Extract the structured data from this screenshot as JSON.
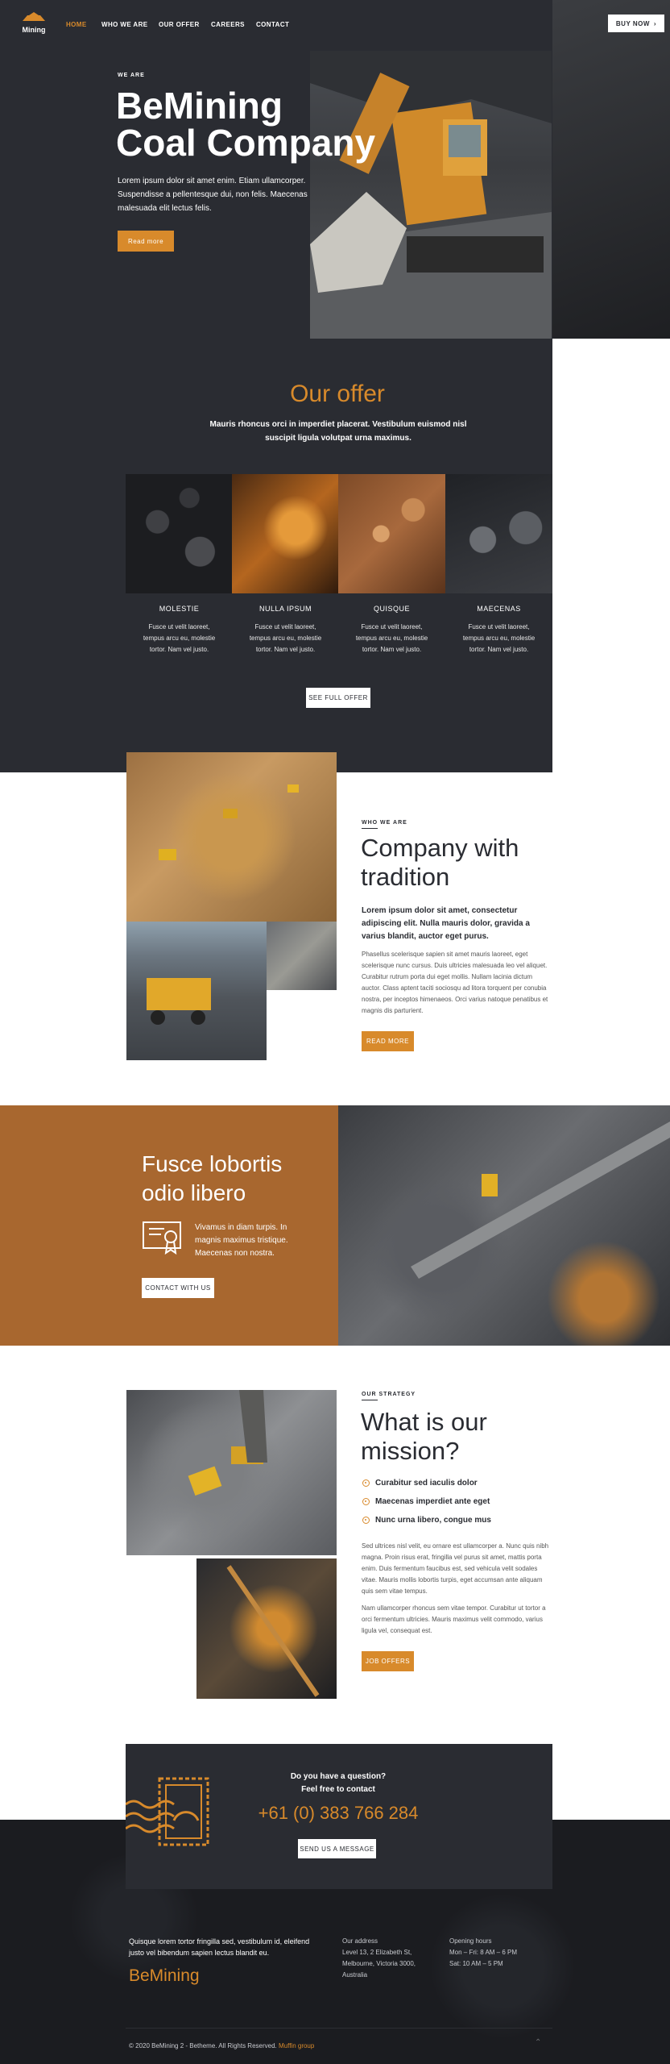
{
  "brand": {
    "logo_text": "Mining",
    "accent": "#d88a2b",
    "dark": "#2a2c32",
    "rust": "#a8672f"
  },
  "nav": {
    "items": [
      "HOME",
      "WHO WE ARE",
      "OUR OFFER",
      "CAREERS",
      "CONTACT"
    ],
    "buy": "BUY NOW"
  },
  "hero": {
    "eyebrow": "WE ARE",
    "title_1": "BeMining",
    "title_2": "Coal Company",
    "text": "Lorem ipsum dolor sit amet enim. Etiam ullamcorper. Suspendisse a pellentesque dui, non felis. Maecenas malesuada elit lectus felis.",
    "button": "Read more"
  },
  "offer": {
    "title": "Our offer",
    "subtitle": "Mauris rhoncus orci in imperdiet placerat. Vestibulum euismod nisl suscipit ligula volutpat urna maximus.",
    "items": [
      {
        "title": "MOLESTIE",
        "text": "Fusce ut velit laoreet, tempus arcu eu, molestie tortor. Nam vel justo."
      },
      {
        "title": "NULLA IPSUM",
        "text": "Fusce ut velit laoreet, tempus arcu eu, molestie tortor. Nam vel justo."
      },
      {
        "title": "QUISQUE",
        "text": "Fusce ut velit laoreet, tempus arcu eu, molestie tortor. Nam vel justo."
      },
      {
        "title": "MAECENAS",
        "text": "Fusce ut velit laoreet, tempus arcu eu, molestie tortor. Nam vel justo."
      }
    ],
    "button": "SEE FULL OFFER"
  },
  "company": {
    "eyebrow": "WHO WE ARE",
    "title_1": "Company with",
    "title_2": "tradition",
    "lead": "Lorem ipsum dolor sit amet, consectetur adipiscing elit. Nulla mauris dolor, gravida a varius blandit, auctor eget purus.",
    "text": "Phasellus scelerisque sapien sit amet mauris laoreet, eget scelerisque nunc cursus. Duis ultricies malesuada leo vel aliquet. Curabitur rutrum porta dui eget mollis. Nullam lacinia dictum auctor. Class aptent taciti sociosqu ad litora torquent per conubia nostra, per inceptos himenaeos. Orci varius natoque penatibus et magnis dis parturient.",
    "button": "READ MORE"
  },
  "promo": {
    "title_1": "Fusce lobortis",
    "title_2": "odio libero",
    "text": "Vivamus in diam turpis. In magnis maximus tristique. Maecenas non nostra.",
    "button": "CONTACT WITH US"
  },
  "mission": {
    "eyebrow": "OUR STRATEGY",
    "title_1": "What is our",
    "title_2": "mission?",
    "checks": [
      "Curabitur sed iaculis dolor",
      "Maecenas imperdiet ante eget",
      "Nunc urna libero, congue mus"
    ],
    "text_1": "Sed ultrices nisl velit, eu ornare est ullamcorper a. Nunc quis nibh magna. Proin risus erat, fringilla vel purus sit amet, mattis porta enim. Duis fermentum faucibus est, sed vehicula velit sodales vitae. Mauris mollis lobortis turpis, eget accumsan ante aliquam quis sem vitae tempus.",
    "text_2": "Nam ullamcorper rhoncus sem vitae tempor. Curabitur ut tortor a orci fermentum ultricies. Mauris maximus velit commodo, varius ligula vel, consequat est.",
    "button": "JOB OFFERS"
  },
  "contact": {
    "line_1": "Do you have a question?",
    "line_2": "Feel free to contact",
    "phone": "+61 (0) 383 766 284",
    "button": "SEND US A MESSAGE"
  },
  "footer": {
    "about": "Quisque lorem tortor fringilla sed, vestibulum id, eleifend justo vel bibendum sapien lectus blandit eu.",
    "brand": "BeMining",
    "addr_title": "Our address",
    "addr": [
      "Level 13, 2 Elizabeth St,",
      "Melbourne, Victoria 3000,",
      "Australia"
    ],
    "hours_title": "Opening hours",
    "hours": [
      "Mon – Fri: 8 AM – 6 PM",
      "Sat: 10 AM – 5 PM"
    ],
    "copy": "© 2020 BeMining 2 - Betheme. All Rights Reserved.",
    "copy_link": "Muffin group"
  }
}
